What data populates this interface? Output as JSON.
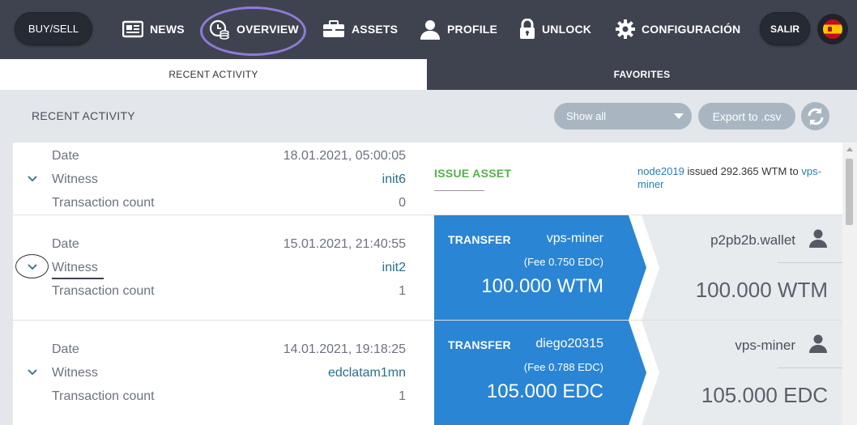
{
  "nav": {
    "buy_sell": "BUY/SELL",
    "items": [
      {
        "label": "NEWS",
        "icon": "newspaper-icon"
      },
      {
        "label": "OVERVIEW",
        "icon": "clock-coins-icon"
      },
      {
        "label": "ASSETS",
        "icon": "briefcase-icon"
      },
      {
        "label": "PROFILE",
        "icon": "user-icon"
      },
      {
        "label": "UNLOCK",
        "icon": "lock-icon"
      },
      {
        "label": "CONFIGURACIÓN",
        "icon": "gear-icon"
      }
    ],
    "exit": "SALIR",
    "language_flag": "spain-flag-icon"
  },
  "tabs": [
    {
      "label": "RECENT ACTIVITY",
      "active": true
    },
    {
      "label": "FAVORITES",
      "active": false
    }
  ],
  "toolbar": {
    "title": "RECENT ACTIVITY",
    "filter_value": "Show all",
    "export_label": "Export to .csv"
  },
  "rows": [
    {
      "date_label": "Date",
      "date": "18.01.2021, 05:00:05",
      "witness_label": "Witness",
      "witness": "init6",
      "count_label": "Transaction count",
      "count": "0",
      "type": "ISSUE ASSET",
      "desc_from": "node2019",
      "desc_text": " issued 292.365 WTM to ",
      "desc_to": "vps-miner"
    },
    {
      "date_label": "Date",
      "date": "15.01.2021, 21:40:55",
      "witness_label": "Witness",
      "witness": "init2",
      "count_label": "Transaction count",
      "count": "1",
      "type": "TRANSFER",
      "from": "vps-miner",
      "fee": "(Fee 0.750 EDC)",
      "amount": "100.000 WTM",
      "to": "p2pb2b.wallet",
      "received": "100.000 WTM"
    },
    {
      "date_label": "Date",
      "date": "14.01.2021, 19:18:25",
      "witness_label": "Witness",
      "witness": "edclatam1mn",
      "count_label": "Transaction count",
      "count": "1",
      "type": "TRANSFER",
      "from": "diego20315",
      "fee": "(Fee 0.788 EDC)",
      "amount": "105.000 EDC",
      "to": "vps-miner",
      "received": "105.000 EDC"
    }
  ],
  "colors": {
    "nav_bg": "#3f4350",
    "transfer_blue": "#2a85d4",
    "issue_green": "#55b04a",
    "overview_highlight": "#8f7ad8"
  }
}
